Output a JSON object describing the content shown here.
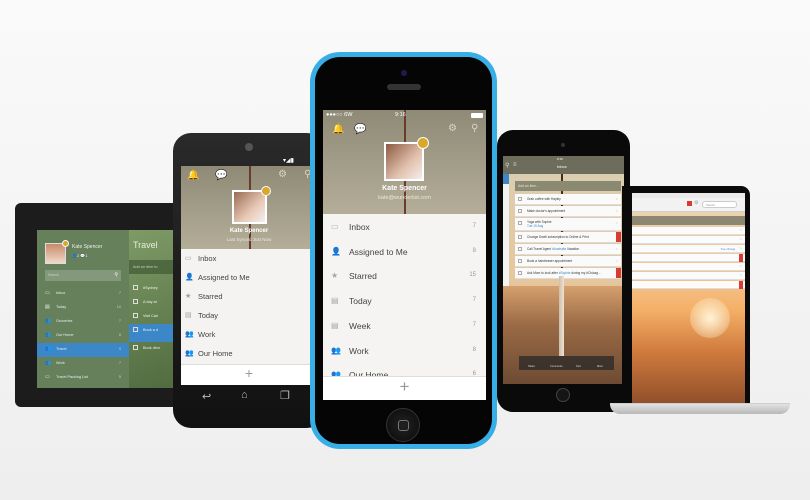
{
  "user": {
    "name": "Kate Spencer",
    "email": "kate@wunderlist.com",
    "last_sync": "Last Synced Just Now"
  },
  "windows_tablet": {
    "stats": {
      "shared": "2",
      "comments": "1"
    },
    "search_placeholder": "Search",
    "sidebar": [
      {
        "label": "Inbox",
        "count": "7",
        "icon": "inbox-icon"
      },
      {
        "label": "Today",
        "count": "10",
        "icon": "calendar-icon"
      },
      {
        "label": "Groceries",
        "count": "7",
        "icon": "people-icon"
      },
      {
        "label": "Our Home",
        "count": "6",
        "icon": "people-icon"
      },
      {
        "label": "Travel",
        "count": "9",
        "icon": "people-icon",
        "active": true
      },
      {
        "label": "Work",
        "count": "7",
        "icon": "people-icon"
      },
      {
        "label": "Travel Packing List",
        "count": "5",
        "icon": "list-icon"
      }
    ],
    "list_title": "Travel",
    "add_placeholder": "Add an item to",
    "tasks": [
      {
        "label": "#Sydney"
      },
      {
        "label": "A day at"
      },
      {
        "label": "Visit Carl"
      },
      {
        "label": "Book a d",
        "active": true
      },
      {
        "label": "Book dinn"
      }
    ]
  },
  "android": {
    "lists": [
      {
        "label": "Inbox",
        "icon": "inbox-icon"
      },
      {
        "label": "Assigned to Me",
        "icon": "assigned-icon"
      },
      {
        "label": "Starred",
        "icon": "star-icon"
      },
      {
        "label": "Today",
        "icon": "calendar-icon"
      },
      {
        "label": "Work",
        "icon": "people-icon"
      },
      {
        "label": "Our Home",
        "icon": "people-icon"
      }
    ],
    "add_label": "+"
  },
  "iphone": {
    "status": {
      "carrier": "●●●○○ 6W",
      "time": "9:16"
    },
    "lists": [
      {
        "label": "Inbox",
        "count": "7",
        "icon": "inbox-icon"
      },
      {
        "label": "Assigned to Me",
        "count": "8",
        "icon": "assigned-icon"
      },
      {
        "label": "Starred",
        "count": "15",
        "icon": "star-icon"
      },
      {
        "label": "Today",
        "count": "7",
        "icon": "calendar-icon"
      },
      {
        "label": "Week",
        "count": "7",
        "icon": "calendar-icon"
      },
      {
        "label": "Work",
        "count": "8",
        "icon": "people-icon"
      },
      {
        "label": "Our Home",
        "count": "6",
        "icon": "people-icon"
      }
    ],
    "add_label": "+"
  },
  "ipad": {
    "status_time": "9:16",
    "title": "Inbox",
    "add_placeholder": "Add an item...",
    "tasks": [
      {
        "label": "Grab coffee with Hayley"
      },
      {
        "label": "Make doctor's appointment"
      },
      {
        "label": "Yoga with Sophie",
        "due": "Tue 19 Aug"
      },
      {
        "label": "Change Dwell subscription to Online & Print",
        "flag": true
      },
      {
        "label": "Call Travel Agent ",
        "hashtag": "#Australia",
        "suffix": " Vacation"
      },
      {
        "label": "Book a hairdresser appointment"
      },
      {
        "label": "Ask Mom to look after ",
        "hashtag": "#Sophie",
        "suffix": " during my #Chicag...",
        "flag": true
      }
    ],
    "toolbar": [
      "Share",
      "Comments",
      "Sort",
      "More"
    ]
  },
  "macbook": {
    "search_placeholder": "Search",
    "due_label": "Tue 19 Aug"
  },
  "colors": {
    "iphone_body": "#38aee6",
    "active_blue": "#3b87c8",
    "tablet_green": "#66805c",
    "flag_red": "#d63c33"
  }
}
